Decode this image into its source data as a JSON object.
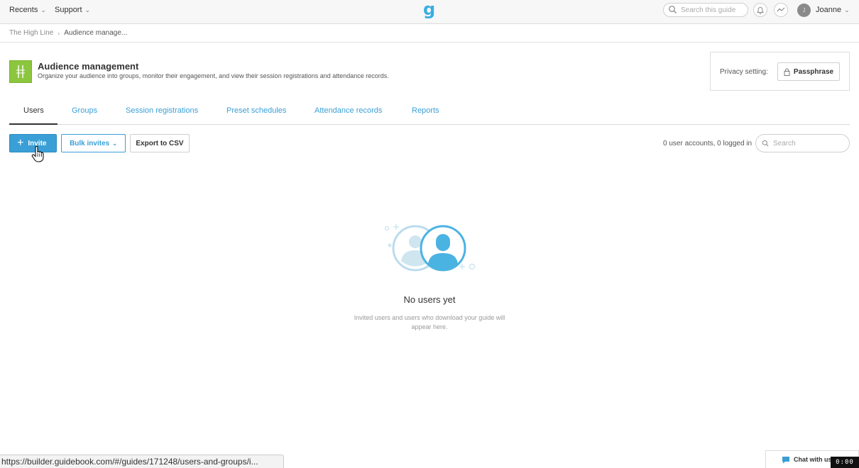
{
  "topbar": {
    "recents_label": "Recents",
    "support_label": "Support",
    "logo_text": "g",
    "search_placeholder": "Search this guide",
    "user_initial": "J",
    "user_name": "Joanne"
  },
  "breadcrumb": {
    "items": [
      "The High Line",
      "Audience manage..."
    ]
  },
  "header": {
    "title": "Audience management",
    "subtitle": "Organize your audience into groups, monitor their engagement,  and view their session registrations and attendance records.",
    "accent_color": "#8cc63f"
  },
  "privacy": {
    "label": "Privacy setting:",
    "button_label": "Passphrase"
  },
  "tabs": [
    {
      "label": "Users",
      "active": true
    },
    {
      "label": "Groups",
      "active": false
    },
    {
      "label": "Session registrations",
      "active": false
    },
    {
      "label": "Preset schedules",
      "active": false
    },
    {
      "label": "Attendance records",
      "active": false
    },
    {
      "label": "Reports",
      "active": false
    }
  ],
  "toolbar": {
    "invite_label": "Invite",
    "bulk_label": "Bulk invites",
    "export_label": "Export to CSV",
    "user_count": "0 user accounts, 0 logged in",
    "search_placeholder": "Search"
  },
  "empty_state": {
    "title": "No users yet",
    "description": "Invited users and users who download your guide will appear here."
  },
  "status_bar": {
    "url": "https://builder.guidebook.com/#/guides/171248/users-and-groups/i..."
  },
  "chat": {
    "label": "Chat with us"
  },
  "recording_badge": "0:00",
  "colors": {
    "link_blue": "#3a9fd6",
    "primary_button": "#3a9fd6",
    "logo": "#3aaee0"
  }
}
